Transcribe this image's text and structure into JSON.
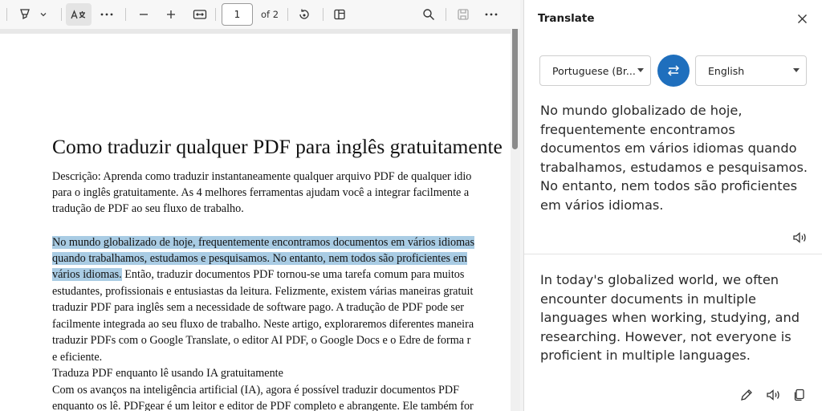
{
  "toolbar": {
    "page_number": "1",
    "page_of": "of 2",
    "icons": [
      "highlight-icon",
      "chevron-down-icon",
      "translate-icon",
      "more-icon",
      "zoom-out-icon",
      "zoom-in-icon",
      "fit-width-icon",
      "rotate-icon",
      "page-view-icon",
      "search-icon",
      "save-icon",
      "more-icon"
    ]
  },
  "document": {
    "title": "Como traduzir qualquer PDF para inglês gratuitamente",
    "description_lines": [
      "Descrição: Aprenda como traduzir instantaneamente qualquer arquivo PDF de qualquer idio",
      "para o inglês gratuitamente. As 4 melhores ferramentas ajudam você a integrar facilmente a",
      "tradução de PDF ao seu fluxo de trabalho."
    ],
    "para_line1": "No mundo globalizado de hoje, frequentemente encontramos documentos em vários idiomas",
    "para_line2": "quando trabalhamos, estudamos e pesquisamos. No entanto, nem todos são proficientes em",
    "para_line3_highlight": "vários idiomas.",
    "para_line3_rest": " Então, traduzir documentos PDF tornou-se uma tarefa comum para muitos",
    "para_lines": [
      "estudantes, profissionais e entusiastas da leitura. Felizmente, existem várias maneiras gratuit",
      "traduzir PDF para inglês sem a necessidade de software pago. A tradução de PDF pode ser",
      "facilmente integrada ao seu fluxo de trabalho. Neste artigo, exploraremos diferentes maneira",
      "traduzir PDFs com o Google Translate, o editor AI PDF, o Google Docs e o Edre de forma r",
      "e eficiente.",
      "Traduza PDF enquanto lê usando IA gratuitamente",
      "Com os avanços na inteligência artificial (IA), agora é possível traduzir documentos PDF",
      "enquanto os lê. PDFgear é um leitor e editor de PDF completo e abrangente. Ele também for"
    ]
  },
  "translate_panel": {
    "title": "Translate",
    "source_language": "Portuguese (Br...",
    "target_language": "English",
    "source_text": "No mundo globalizado de hoje, frequentemente encontramos documentos em vários idiomas quando trabalhamos, estudamos e pesquisamos. No entanto, nem todos são proficientes em vários idiomas.",
    "translated_text": "In today's globalized world, we often encounter documents in multiple languages when working, studying, and researching. However, not everyone is proficient in multiple languages.",
    "accent_color": "#1f6fbd",
    "highlight_color": "#a9cce4"
  }
}
